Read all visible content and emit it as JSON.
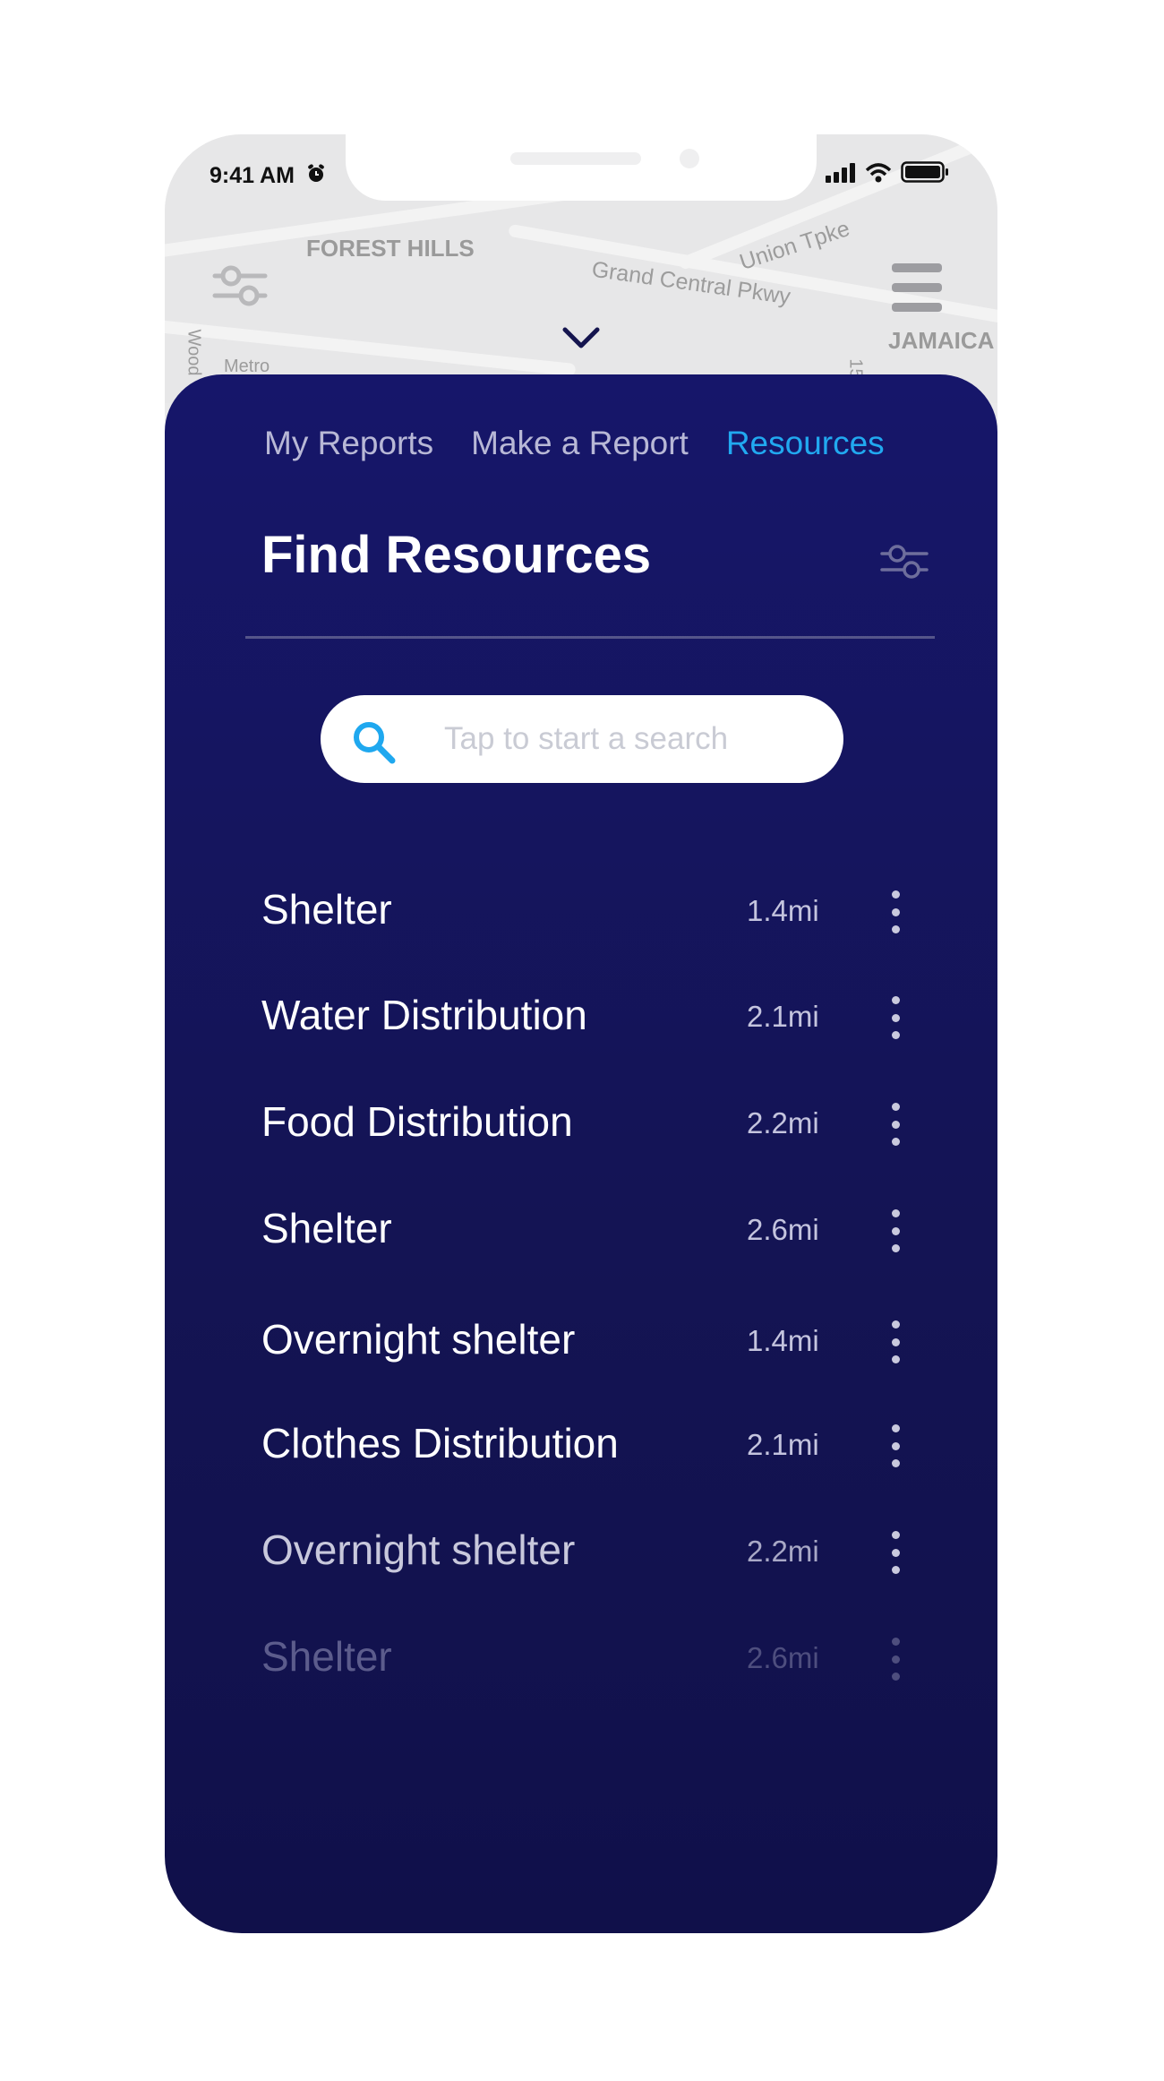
{
  "status_bar": {
    "time": "9:41 AM",
    "icons": [
      "alarm-icon",
      "signal-icon",
      "wifi-icon",
      "battery-icon"
    ]
  },
  "map": {
    "labels": [
      "FOREST HILLS",
      "Union Tpke",
      "Grand Central Pkwy",
      "JAMAICA",
      "Wood",
      "Metro",
      "15"
    ],
    "icons": [
      "filter-icon",
      "menu-icon",
      "chevron-down-icon"
    ]
  },
  "tabs": [
    {
      "label": "My Reports",
      "active": false
    },
    {
      "label": "Make a Report",
      "active": false
    },
    {
      "label": "Resources",
      "active": true
    }
  ],
  "page": {
    "title": "Find Resources"
  },
  "search": {
    "placeholder": "Tap to start a search",
    "value": ""
  },
  "resources": [
    {
      "name": "Shelter",
      "distance": "1.4mi"
    },
    {
      "name": "Water Distribution",
      "distance": "2.1mi"
    },
    {
      "name": "Food Distribution",
      "distance": "2.2mi"
    },
    {
      "name": "Shelter",
      "distance": "2.6mi"
    },
    {
      "name": "Overnight shelter",
      "distance": "1.4mi"
    },
    {
      "name": "Clothes Distribution",
      "distance": "2.1mi"
    },
    {
      "name": "Overnight shelter",
      "distance": "2.2mi"
    },
    {
      "name": "Shelter",
      "distance": "2.6mi"
    }
  ],
  "colors": {
    "sheet_background": "#141454",
    "accent": "#21a9f0",
    "text_primary": "#ffffff",
    "text_secondary": "#c4c4de"
  }
}
